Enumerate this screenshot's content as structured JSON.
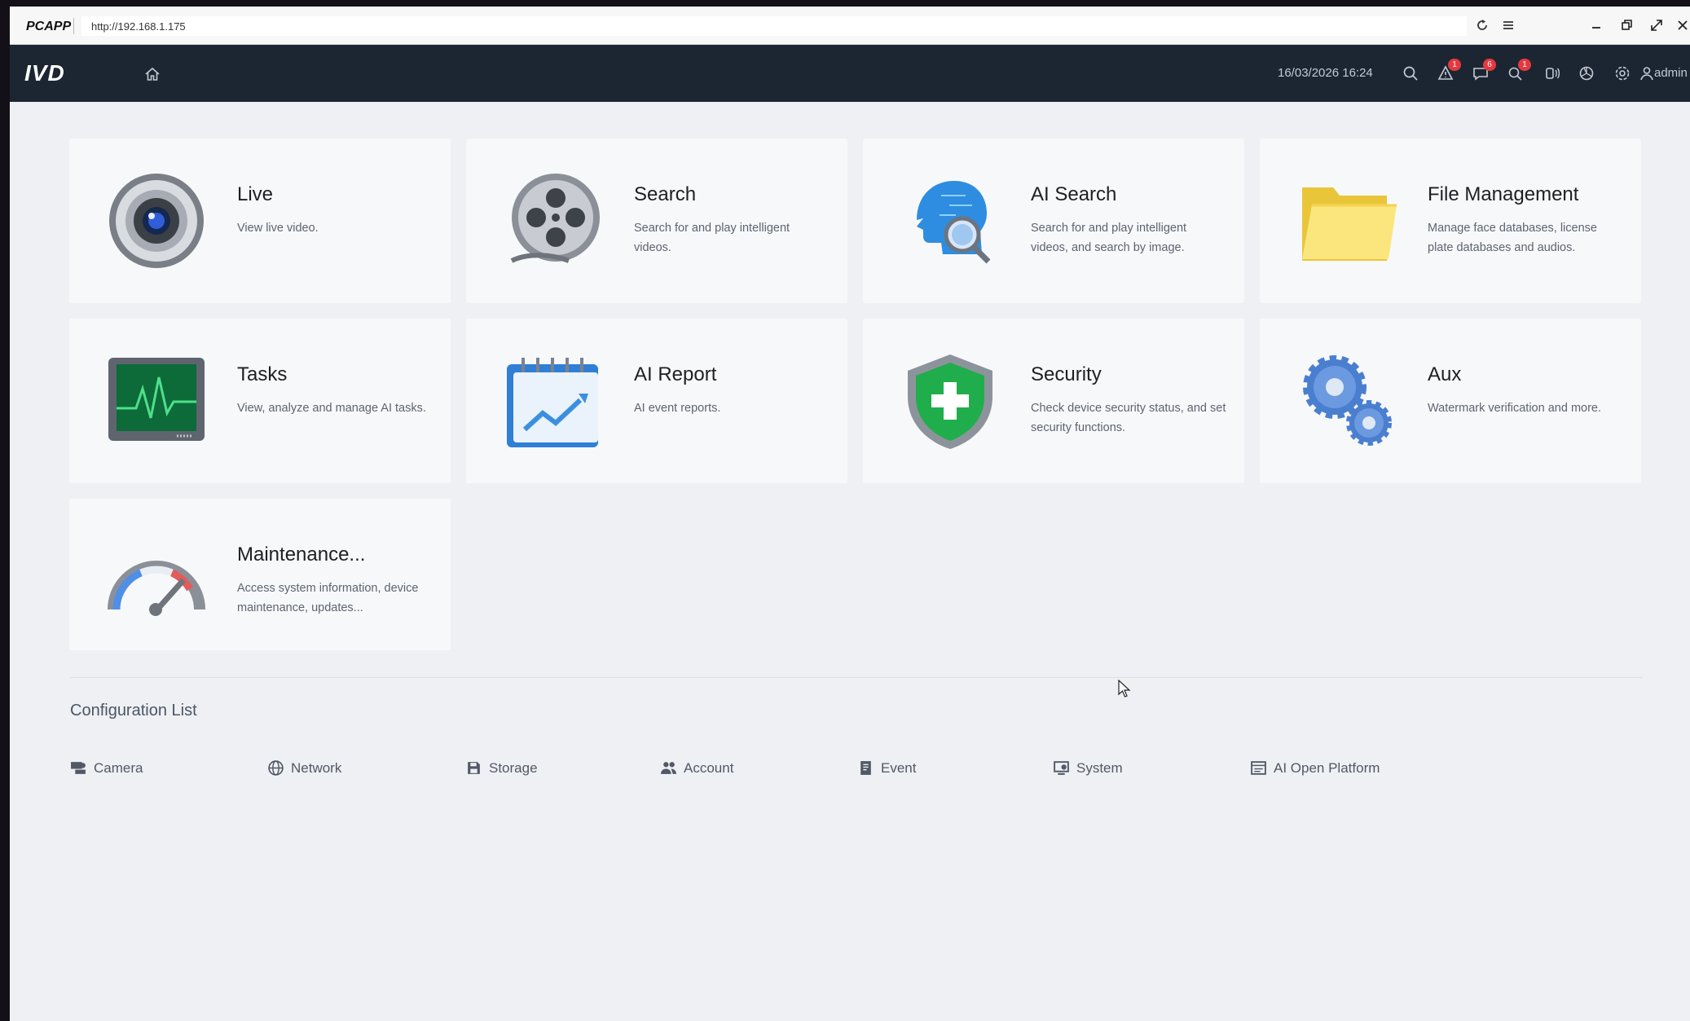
{
  "browser": {
    "brand": "PCAPP",
    "url": "http://192.168.1.175",
    "icons": [
      "refresh-icon",
      "menu-icon",
      "minimize-icon",
      "restore-icon",
      "fullscreen-icon",
      "close-icon"
    ]
  },
  "header": {
    "logo": "IVD",
    "datetime": "16/03/2026 16:24",
    "user": "admin",
    "badges": {
      "alarm": "1",
      "message": "6",
      "intelligent": "1"
    }
  },
  "cards": [
    {
      "title": "Live",
      "desc": "View live video.",
      "icon": "camera-lens-icon"
    },
    {
      "title": "Search",
      "desc": "Search for and play intelligent videos.",
      "icon": "film-reel-icon"
    },
    {
      "title": "AI Search",
      "desc": "Search for and play intelligent videos, and search by image.",
      "icon": "ai-head-magnifier-icon"
    },
    {
      "title": "File Management",
      "desc": "Manage face databases, license plate databases and audios.",
      "icon": "folder-icon"
    },
    {
      "title": "Tasks",
      "desc": "View, analyze and manage AI tasks.",
      "icon": "monitor-pulse-icon"
    },
    {
      "title": "AI Report",
      "desc": "AI event reports.",
      "icon": "calendar-chart-icon"
    },
    {
      "title": "Security",
      "desc": "Check device security status, and set security functions.",
      "icon": "shield-plus-icon"
    },
    {
      "title": "Aux",
      "desc": "Watermark verification and more.",
      "icon": "gears-icon"
    },
    {
      "title": "Maintenance...",
      "desc": "Access system information, device maintenance, updates...",
      "icon": "speedometer-icon"
    }
  ],
  "config": {
    "title": "Configuration List",
    "items": [
      {
        "label": "Camera",
        "icon": "camera-icon"
      },
      {
        "label": "Network",
        "icon": "globe-icon"
      },
      {
        "label": "Storage",
        "icon": "floppy-icon"
      },
      {
        "label": "Account",
        "icon": "users-icon"
      },
      {
        "label": "Event",
        "icon": "event-list-icon"
      },
      {
        "label": "System",
        "icon": "system-icon"
      },
      {
        "label": "AI Open Platform",
        "icon": "platform-icon"
      }
    ]
  },
  "colors": {
    "header_bg": "#1c2633",
    "page_bg": "#eef0f3",
    "card_bg": "#f7f8fa",
    "badge": "#e5393f"
  }
}
